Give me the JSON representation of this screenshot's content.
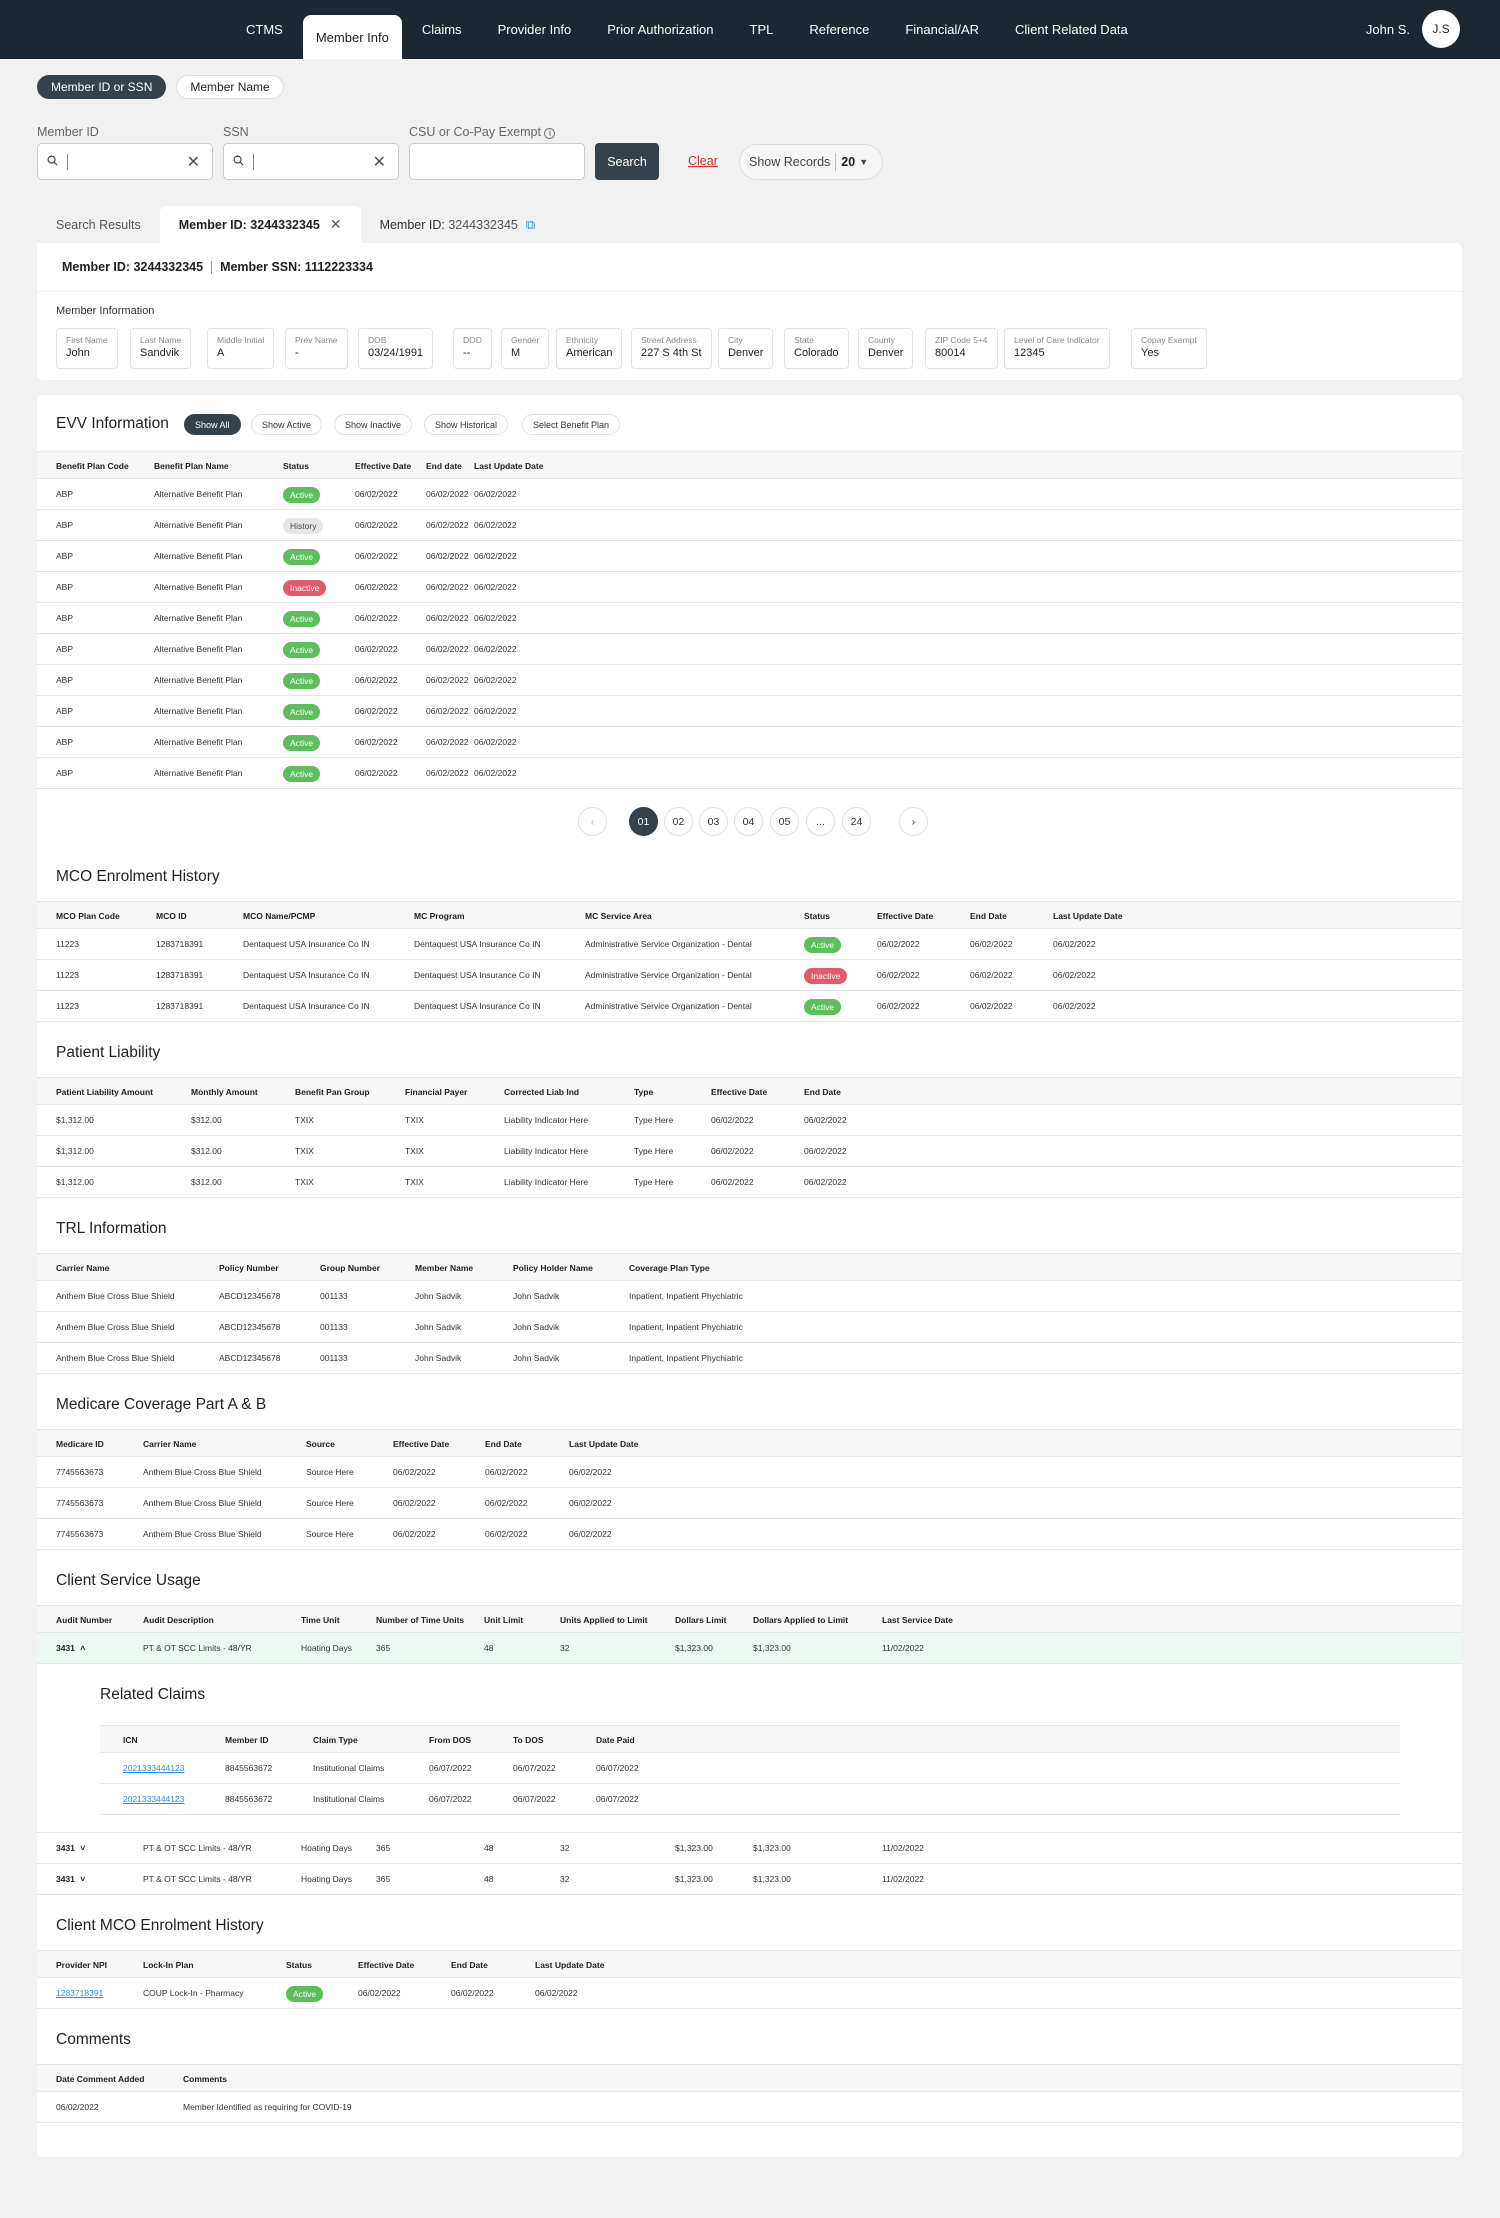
{
  "nav": {
    "tabs": [
      "CTMS",
      "Member Info",
      "Claims",
      "Provider Info",
      "Prior Authorization",
      "TPL",
      "Reference",
      "Financial/AR",
      "Client Related Data"
    ],
    "active": "Member Info",
    "user_name": "John S.",
    "user_initials": "J.S"
  },
  "search": {
    "mode_pills": [
      "Member ID or SSN",
      "Member Name"
    ],
    "member_id_label": "Member ID",
    "ssn_label": "SSN",
    "csu_label": "CSU or Co-Pay Exempt",
    "search_btn": "Search",
    "clear_btn": "Clear",
    "show_records_label": "Show Records",
    "show_records_value": "20"
  },
  "result_tabs": {
    "search_results": "Search Results",
    "active_tab": "Member ID: 3244332345",
    "other_tab_prefix": "Member ID: ",
    "other_tab_value": "3244332345"
  },
  "member_header": {
    "member_id": "Member ID: 3244332345",
    "member_ssn": "Member SSN: 1112223334"
  },
  "member_info": {
    "title": "Member Information",
    "fields": [
      {
        "k": "First Name",
        "v": "John"
      },
      {
        "k": "Last Name",
        "v": "Sandvik"
      },
      {
        "k": "Middle Initial",
        "v": "A"
      },
      {
        "k": "Prev Name",
        "v": "-"
      },
      {
        "k": "DOB",
        "v": "03/24/1991"
      },
      {
        "k": "DOD",
        "v": "--"
      },
      {
        "k": "Gender",
        "v": "M"
      },
      {
        "k": "Ethnicity",
        "v": "American"
      },
      {
        "k": "Street Address",
        "v": "227 S 4th St"
      },
      {
        "k": "City",
        "v": "Denver"
      },
      {
        "k": "State",
        "v": "Colorado"
      },
      {
        "k": "County",
        "v": "Denver"
      },
      {
        "k": "ZIP Code 5+4",
        "v": "80014"
      },
      {
        "k": "Level of Care Indicator",
        "v": "12345"
      },
      {
        "k": "Copay Exempt",
        "v": "Yes"
      }
    ]
  },
  "evv": {
    "title": "EVV Information",
    "filters": [
      "Show All",
      "Show Active",
      "Show Inactive",
      "Show Historical",
      "Select Benefit Plan"
    ],
    "headers": [
      "Benefit Plan Code",
      "Benefit Plan Name",
      "Status",
      "Effective Date",
      "End date",
      "Last Update Date"
    ],
    "rows": [
      [
        "ABP",
        "Alternative Benefit Plan",
        "Active",
        "06/02/2022",
        "06/02/2022",
        "06/02/2022"
      ],
      [
        "ABP",
        "Alternative Benefit Plan",
        "History",
        "06/02/2022",
        "06/02/2022",
        "06/02/2022"
      ],
      [
        "ABP",
        "Alternative Benefit Plan",
        "Active",
        "06/02/2022",
        "06/02/2022",
        "06/02/2022"
      ],
      [
        "ABP",
        "Alternative Benefit Plan",
        "Inactive",
        "06/02/2022",
        "06/02/2022",
        "06/02/2022"
      ],
      [
        "ABP",
        "Alternative Benefit Plan",
        "Active",
        "06/02/2022",
        "06/02/2022",
        "06/02/2022"
      ],
      [
        "ABP",
        "Alternative Benefit Plan",
        "Active",
        "06/02/2022",
        "06/02/2022",
        "06/02/2022"
      ],
      [
        "ABP",
        "Alternative Benefit Plan",
        "Active",
        "06/02/2022",
        "06/02/2022",
        "06/02/2022"
      ],
      [
        "ABP",
        "Alternative Benefit Plan",
        "Active",
        "06/02/2022",
        "06/02/2022",
        "06/02/2022"
      ],
      [
        "ABP",
        "Alternative Benefit Plan",
        "Active",
        "06/02/2022",
        "06/02/2022",
        "06/02/2022"
      ],
      [
        "ABP",
        "Alternative Benefit Plan",
        "Active",
        "06/02/2022",
        "06/02/2022",
        "06/02/2022"
      ]
    ],
    "pages": [
      "01",
      "02",
      "03",
      "04",
      "05",
      "...",
      "24"
    ],
    "active_page": "01"
  },
  "mco": {
    "title": "MCO Enrolment History",
    "headers": [
      "MCO Plan Code",
      "MCO ID",
      "MCO Name/PCMP",
      "MC Program",
      "MC Service Area",
      "Status",
      "Effective Date",
      "End Date",
      "Last Update Date"
    ],
    "rows": [
      [
        "11223",
        "1283718391",
        "Dentaquest USA Insurance Co IN",
        "Dentaquest USA Insurance Co IN",
        "Administrative Service Organization - Dental",
        "Active",
        "06/02/2022",
        "06/02/2022",
        "06/02/2022"
      ],
      [
        "11223",
        "1283718391",
        "Dentaquest USA Insurance Co IN",
        "Dentaquest USA Insurance Co IN",
        "Administrative Service Organization - Dental",
        "Inactive",
        "06/02/2022",
        "06/02/2022",
        "06/02/2022"
      ],
      [
        "11223",
        "1283718391",
        "Dentaquest USA Insurance Co IN",
        "Dentaquest USA Insurance Co IN",
        "Administrative Service Organization - Dental",
        "Active",
        "06/02/2022",
        "06/02/2022",
        "06/02/2022"
      ]
    ]
  },
  "liability": {
    "title": "Patient Liability",
    "headers": [
      "Patient Liability Amount",
      "Monthly Amount",
      "Benefit Pan Group",
      "Financial Payer",
      "Corrected Liab Ind",
      "Type",
      "Effective Date",
      "End Date"
    ],
    "rows": [
      [
        "$1,312.00",
        "$312.00",
        "TXIX",
        "TXIX",
        "Liability Indicator Here",
        "Type Here",
        "06/02/2022",
        "06/02/2022"
      ],
      [
        "$1,312.00",
        "$312.00",
        "TXIX",
        "TXIX",
        "Liability Indicator Here",
        "Type Here",
        "06/02/2022",
        "06/02/2022"
      ],
      [
        "$1,312.00",
        "$312.00",
        "TXIX",
        "TXIX",
        "Liability Indicator Here",
        "Type Here",
        "06/02/2022",
        "06/02/2022"
      ]
    ]
  },
  "trl": {
    "title": "TRL Information",
    "headers": [
      "Carrier Name",
      "Policy Number",
      "Group Number",
      "Member Name",
      "Policy Holder Name",
      "Coverage Plan Type"
    ],
    "rows": [
      [
        "Anthem Blue Cross Blue Shield",
        "ABCD12345678",
        "001133",
        "John Sadvik",
        "John Sadvik",
        "Inpatient, Inpatient Phychiatric"
      ],
      [
        "Anthem Blue Cross Blue Shield",
        "ABCD12345678",
        "001133",
        "John Sadvik",
        "John Sadvik",
        "Inpatient, Inpatient Phychiatric"
      ],
      [
        "Anthem Blue Cross Blue Shield",
        "ABCD12345678",
        "001133",
        "John Sadvik",
        "John Sadvik",
        "Inpatient, Inpatient Phychiatric"
      ]
    ]
  },
  "medicare": {
    "title": "Medicare Coverage Part A & B",
    "headers": [
      "Medicare ID",
      "Carrier Name",
      "Source",
      "Effective Date",
      "End Date",
      "Last Update Date"
    ],
    "rows": [
      [
        "7745563673",
        "Anthem Blue Cross Blue Shield",
        "Source Here",
        "06/02/2022",
        "06/02/2022",
        "06/02/2022"
      ],
      [
        "7745563673",
        "Anthem Blue Cross Blue Shield",
        "Source Here",
        "06/02/2022",
        "06/02/2022",
        "06/02/2022"
      ],
      [
        "7745563673",
        "Anthem Blue Cross Blue Shield",
        "Source Here",
        "06/02/2022",
        "06/02/2022",
        "06/02/2022"
      ]
    ]
  },
  "csu": {
    "title": "Client Service Usage",
    "headers": [
      "Audit Number",
      "Audit Description",
      "Time Unit",
      "Number of Time Units",
      "Unit Limit",
      "Units Applied to Limit",
      "Dollars Limit",
      "Dollars Applied to Limit",
      "Last Service Date"
    ],
    "rows": [
      [
        "3431",
        "PT & OT SCC Limits - 48/YR",
        "Hoating Days",
        "365",
        "48",
        "32",
        "$1,323.00",
        "$1,323.00",
        "11/02/2022"
      ],
      [
        "3431",
        "PT & OT SCC Limits - 48/YR",
        "Hoating Days",
        "365",
        "48",
        "32",
        "$1,323.00",
        "$1,323.00",
        "11/02/2022"
      ],
      [
        "3431",
        "PT & OT SCC Limits - 48/YR",
        "Hoating Days",
        "365",
        "48",
        "32",
        "$1,323.00",
        "$1,323.00",
        "11/02/2022"
      ]
    ],
    "related_title": "Related Claims",
    "related_headers": [
      "ICN",
      "Member ID",
      "Claim Type",
      "From DOS",
      "To DOS",
      "Date Paid"
    ],
    "related_rows": [
      [
        "2021333444123",
        "8845563672",
        "Institutional Claims",
        "06/07/2022",
        "06/07/2022",
        "06/07/2022"
      ],
      [
        "2021333444123",
        "8845563672",
        "Institutional Claims",
        "06/07/2022",
        "06/07/2022",
        "06/07/2022"
      ]
    ]
  },
  "client_mco": {
    "title": "Client MCO Enrolment History",
    "headers": [
      "Provider NPI",
      "Lock-In Plan",
      "Status",
      "Effective Date",
      "End Date",
      "Last Update Date"
    ],
    "rows": [
      [
        "1283718391",
        "COUP Lock-In - Pharmacy",
        "Active",
        "06/02/2022",
        "06/02/2022",
        "06/02/2022"
      ]
    ]
  },
  "comments": {
    "title": "Comments",
    "headers": [
      "Date Comment Added",
      "Comments"
    ],
    "rows": [
      [
        "06/02/2022",
        "Member Identified as requiring for COVID-19"
      ]
    ]
  }
}
